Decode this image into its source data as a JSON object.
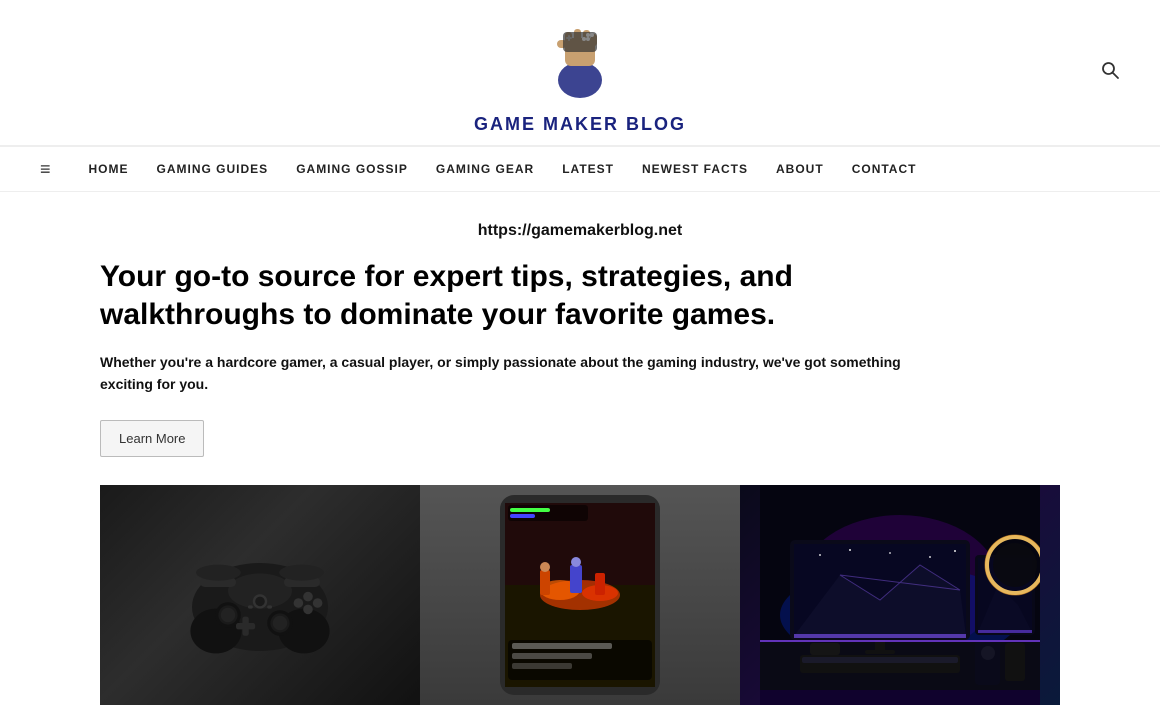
{
  "header": {
    "site_title": "GAME MAKER BLOG",
    "search_label": "search"
  },
  "nav": {
    "hamburger_icon": "≡",
    "items": [
      {
        "label": "HOME",
        "url": "#"
      },
      {
        "label": "GAMING GUIDES",
        "url": "#"
      },
      {
        "label": "GAMING GOSSIP",
        "url": "#"
      },
      {
        "label": "GAMING GEAR",
        "url": "#"
      },
      {
        "label": "LATEST",
        "url": "#"
      },
      {
        "label": "NEWEST FACTS",
        "url": "#"
      },
      {
        "label": "ABOUT",
        "url": "#"
      },
      {
        "label": "CONTACT",
        "url": "#"
      }
    ]
  },
  "main": {
    "site_url": "https://gamemakerblog.net",
    "hero_heading": "Your go-to source for expert tips, strategies, and walkthroughs to dominate your favorite games.",
    "hero_subtext": "Whether you're a hardcore gamer, a casual player, or simply passionate about the gaming industry, we've got something exciting for you.",
    "learn_more_label": "Learn More",
    "images": [
      {
        "alt": "Xbox controller",
        "type": "controller"
      },
      {
        "alt": "Mobile game screenshot",
        "type": "mobile-game"
      },
      {
        "alt": "Gaming setup with monitors",
        "type": "gaming-setup"
      }
    ]
  }
}
